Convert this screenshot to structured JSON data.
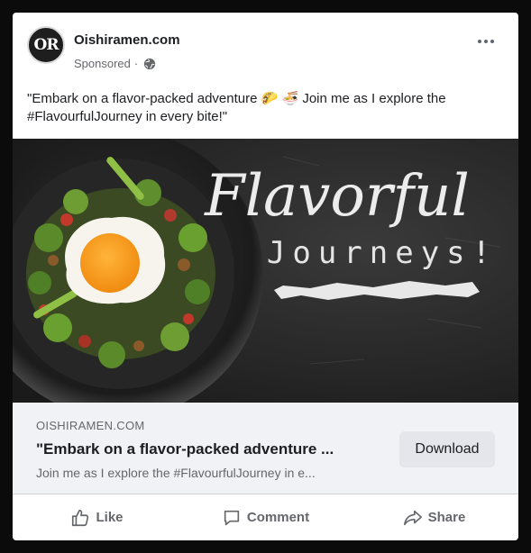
{
  "post": {
    "avatar_text": "OR",
    "page_name": "Oishiramen.com",
    "sponsored_label": "Sponsored",
    "separator": "·",
    "text": "\"Embark on a flavor-packed adventure 🌮 🍜 Join me as I explore the #FlavourfulJourney in every bite!\""
  },
  "image": {
    "headline": "Flavorful",
    "subheadline": "Journeys!"
  },
  "link": {
    "domain": "OISHIRAMEN.COM",
    "title": "\"Embark on a flavor-packed adventure ...",
    "description": "Join me as I explore the #FlavourfulJourney in e...",
    "cta_label": "Download"
  },
  "actions": {
    "like_label": "Like",
    "comment_label": "Comment",
    "share_label": "Share"
  },
  "colors": {
    "card_bg": "#ffffff",
    "link_box_bg": "#f0f2f5",
    "button_bg": "#e4e6eb",
    "muted_text": "#65676b",
    "egg_yolk": "#f39a1c"
  },
  "icons": [
    "globe-icon",
    "more-options-icon",
    "like-icon",
    "comment-icon",
    "share-icon"
  ]
}
